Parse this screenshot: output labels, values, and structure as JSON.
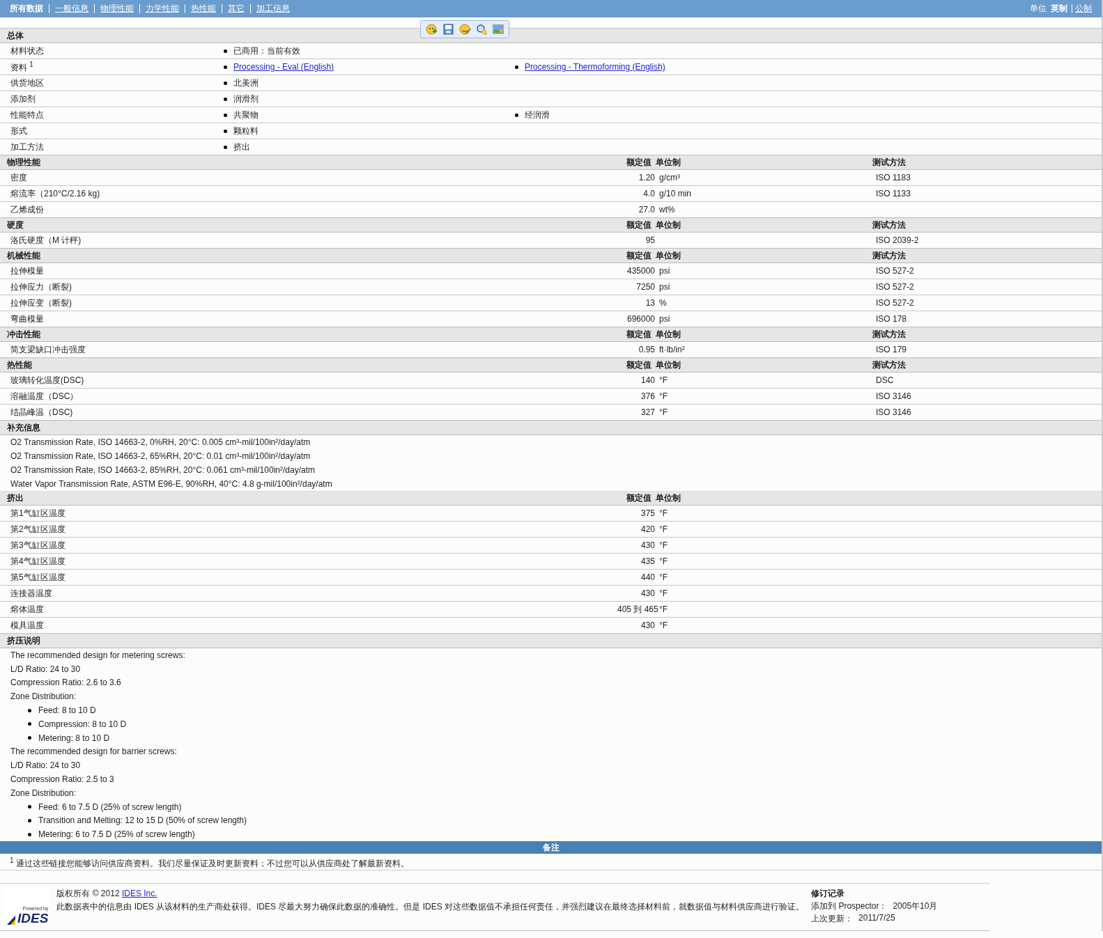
{
  "nav": {
    "items": [
      {
        "label": "所有数据",
        "selected": true
      },
      {
        "label": "一般信息",
        "selected": false
      },
      {
        "label": "物理性能",
        "selected": false
      },
      {
        "label": "力学性能",
        "selected": false
      },
      {
        "label": "热性能",
        "selected": false
      },
      {
        "label": "其它",
        "selected": false
      },
      {
        "label": "加工信息",
        "selected": false
      }
    ],
    "units": {
      "label": "单位",
      "options": [
        {
          "label": "英制",
          "selected": true
        },
        {
          "label": "公制",
          "selected": false
        }
      ]
    }
  },
  "sections": [
    {
      "kind": "bullets",
      "title": "总体",
      "rows": [
        {
          "label": "材料状态",
          "items": [
            {
              "text": "已商用：当前有效",
              "link": false
            }
          ]
        },
        {
          "label": "资料 $^{1}$",
          "items": [
            {
              "text": "Processing - Eval (English)",
              "link": true
            },
            {
              "text": "Processing - Thermoforming (English)",
              "link": true
            }
          ]
        },
        {
          "label": "供货地区",
          "items": [
            {
              "text": "北美洲",
              "link": false
            }
          ]
        },
        {
          "label": "添加剂",
          "items": [
            {
              "text": "润滑剂",
              "link": false
            }
          ]
        },
        {
          "label": "性能特点",
          "items": [
            {
              "text": "共聚物",
              "link": false
            },
            {
              "text": "经润滑",
              "link": false
            }
          ]
        },
        {
          "label": "形式",
          "items": [
            {
              "text": "颗粒料",
              "link": false
            }
          ]
        },
        {
          "label": "加工方法",
          "items": [
            {
              "text": "挤出",
              "link": false
            }
          ]
        }
      ]
    },
    {
      "kind": "properties",
      "title": "物理性能",
      "columns": [
        "额定值",
        "单位制",
        "测试方法"
      ],
      "rows": [
        {
          "label": "密度",
          "value": "1.20",
          "unit": "g/cm³",
          "method": "ISO 1183"
        },
        {
          "label": "熔流率（210°C/2.16 kg)",
          "value": "4.0",
          "unit": "g/10 min",
          "method": "ISO 1133"
        },
        {
          "label": "乙烯成份",
          "value": "27.0",
          "unit": "wt%",
          "method": ""
        }
      ]
    },
    {
      "kind": "properties",
      "title": "硬度",
      "columns": [
        "额定值",
        "单位制",
        "测试方法"
      ],
      "rows": [
        {
          "label": "洛氏硬度（M 计秤)",
          "value": "95",
          "unit": "",
          "method": "ISO 2039-2"
        }
      ]
    },
    {
      "kind": "properties",
      "title": "机械性能",
      "columns": [
        "额定值",
        "单位制",
        "测试方法"
      ],
      "rows": [
        {
          "label": "拉伸模量",
          "value": "435000",
          "unit": "psi",
          "method": "ISO 527-2"
        },
        {
          "label": "拉伸应力（断裂)",
          "value": "7250",
          "unit": "psi",
          "method": "ISO 527-2"
        },
        {
          "label": "拉伸应变（断裂)",
          "value": "13",
          "unit": "%",
          "method": "ISO 527-2"
        },
        {
          "label": "弯曲模量",
          "value": "696000",
          "unit": "psi",
          "method": "ISO 178"
        }
      ]
    },
    {
      "kind": "properties",
      "title": "冲击性能",
      "columns": [
        "额定值",
        "单位制",
        "测试方法"
      ],
      "rows": [
        {
          "label": "简支梁缺口冲击强度",
          "value": "0.95",
          "unit": "ft·lb/in²",
          "method": "ISO 179"
        }
      ]
    },
    {
      "kind": "properties",
      "title": "热性能",
      "columns": [
        "额定值",
        "单位制",
        "测试方法"
      ],
      "rows": [
        {
          "label": "玻璃转化温度(DSC)",
          "value": "140",
          "unit": "°F",
          "method": "DSC"
        },
        {
          "label": "溶融温度（DSC）",
          "value": "376",
          "unit": "°F",
          "method": "ISO 3146"
        },
        {
          "label": "结晶峰温（DSC)",
          "value": "327",
          "unit": "°F",
          "method": "ISO 3146"
        }
      ]
    },
    {
      "kind": "notes",
      "title": "补充信息",
      "lines": [
        "O2 Transmission Rate, ISO 14663-2, 0%RH, 20°C: 0.005 cm³-mil/100in²/day/atm",
        "O2 Transmission Rate, ISO 14663-2, 65%RH, 20°C: 0.01 cm³-mil/100in²/day/atm",
        "O2 Transmission Rate, ISO 14663-2, 85%RH, 20°C: 0.061 cm³-mil/100in²/day/atm",
        "Water Vapor Transmission Rate, ASTM E96-E, 90%RH, 40°C: 4.8 g-mil/100in²/day/atm"
      ]
    },
    {
      "kind": "properties",
      "title": "挤出",
      "columns": [
        "额定值",
        "单位制"
      ],
      "rows": [
        {
          "label": "第1气缸区温度",
          "value": "375",
          "unit": "°F",
          "method": ""
        },
        {
          "label": "第2气缸区温度",
          "value": "420",
          "unit": "°F",
          "method": ""
        },
        {
          "label": "第3气缸区温度",
          "value": "430",
          "unit": "°F",
          "method": ""
        },
        {
          "label": "第4气缸区温度",
          "value": "435",
          "unit": "°F",
          "method": ""
        },
        {
          "label": "第5气缸区温度",
          "value": "440",
          "unit": "°F",
          "method": ""
        },
        {
          "label": "连接器温度",
          "value": "430",
          "unit": "°F",
          "method": ""
        },
        {
          "label": "熔体温度",
          "value": "405 到  465",
          "unit": "°F",
          "method": ""
        },
        {
          "label": "模具温度",
          "value": "430",
          "unit": "°F",
          "method": ""
        }
      ]
    },
    {
      "kind": "text",
      "title": "挤压说明",
      "lines": [
        {
          "kind": "line",
          "text": "The recommended design for metering screws:"
        },
        {
          "kind": "line",
          "text": "L/D Ratio: 24 to 30"
        },
        {
          "kind": "line",
          "text": "Compression Ratio: 2.6 to 3.6"
        },
        {
          "kind": "line",
          "text": "Zone Distribution:"
        },
        {
          "kind": "bullet",
          "text": "Feed: 8 to 10 D"
        },
        {
          "kind": "bullet",
          "text": "Compression: 8 to 10 D"
        },
        {
          "kind": "bullet",
          "text": "Metering: 8 to 10 D"
        },
        {
          "kind": "line",
          "text": "The recommended design for barrier screws:"
        },
        {
          "kind": "line",
          "text": "L/D Ratio: 24 to 30"
        },
        {
          "kind": "line",
          "text": "Compression Ratio: 2.5 to 3"
        },
        {
          "kind": "line",
          "text": "Zone Distribution:"
        },
        {
          "kind": "bullet",
          "text": "Feed: 6 to 7.5 D (25% of screw length)"
        },
        {
          "kind": "bullet",
          "text": "Transition and Melting: 12 to 15 D (50% of screw length)"
        },
        {
          "kind": "bullet",
          "text": "Metering: 6 to 7.5 D (25% of screw length)"
        }
      ]
    }
  ],
  "remarks": {
    "title": "备注",
    "footnote": "$^{1}$ 通过这些链接您能够访问供应商资料。我们尽量保证及时更新资料；不过您可以从供应商处了解最新资料。"
  },
  "footer": {
    "logo": {
      "tagline": "Powered by",
      "name": "IDES"
    },
    "copyright": "版权所有 © 2012",
    "company_link": "IDES Inc.",
    "disclaimer": "此数据表中的信息由 IDES 从该材料的生产商处获得。IDES 尽最大努力确保此数据的准确性。但是 IDES 对这些数据值不承担任何责任，并强烈建议在最终选择材料前，就数据值与材料供应商进行验证。",
    "revisions": {
      "title": "修订记录",
      "entries": [
        {
          "label": "添加到 Prospector：",
          "value": "2005年10月"
        },
        {
          "label": "上次更新：",
          "value": "2011/7/25"
        }
      ]
    }
  }
}
